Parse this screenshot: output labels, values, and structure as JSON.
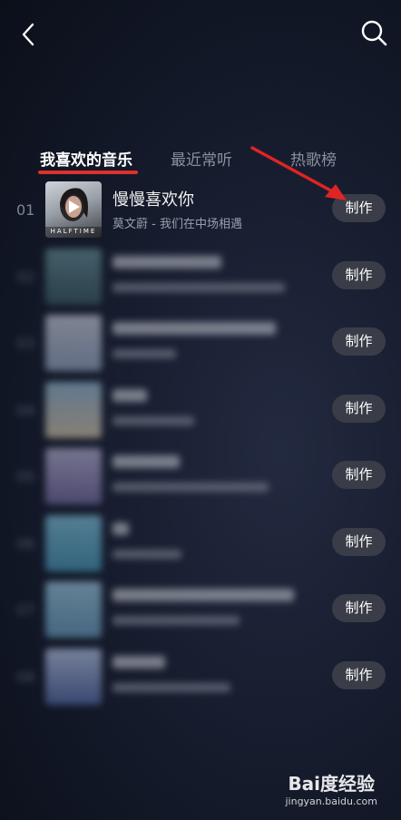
{
  "tabs": [
    {
      "label": "我喜欢的音乐"
    },
    {
      "label": "最近常听"
    },
    {
      "label": "热歌榜"
    }
  ],
  "songs": [
    {
      "number": "01",
      "title": "慢慢喜欢你",
      "subtitle": "莫文蔚 - 我们在中场相遇",
      "cover_text": "HALFTIME",
      "action": "制作"
    },
    {
      "number": "02",
      "title": "",
      "subtitle": "",
      "action": "制作"
    },
    {
      "number": "03",
      "title": "",
      "subtitle": "",
      "action": "制作"
    },
    {
      "number": "04",
      "title": "",
      "subtitle": "",
      "action": "制作"
    },
    {
      "number": "05",
      "title": "",
      "subtitle": "",
      "action": "制作"
    },
    {
      "number": "06",
      "title": "",
      "subtitle": "",
      "action": "制作"
    },
    {
      "number": "07",
      "title": "",
      "subtitle": "",
      "action": "制作"
    },
    {
      "number": "08",
      "title": "",
      "subtitle": "",
      "action": "制作"
    }
  ],
  "watermark": {
    "main": "Bai度经验",
    "sub": "jingyan.baidu.com"
  },
  "colors": {
    "accent": "#e0302e",
    "button_bg": "#3a3d47"
  }
}
